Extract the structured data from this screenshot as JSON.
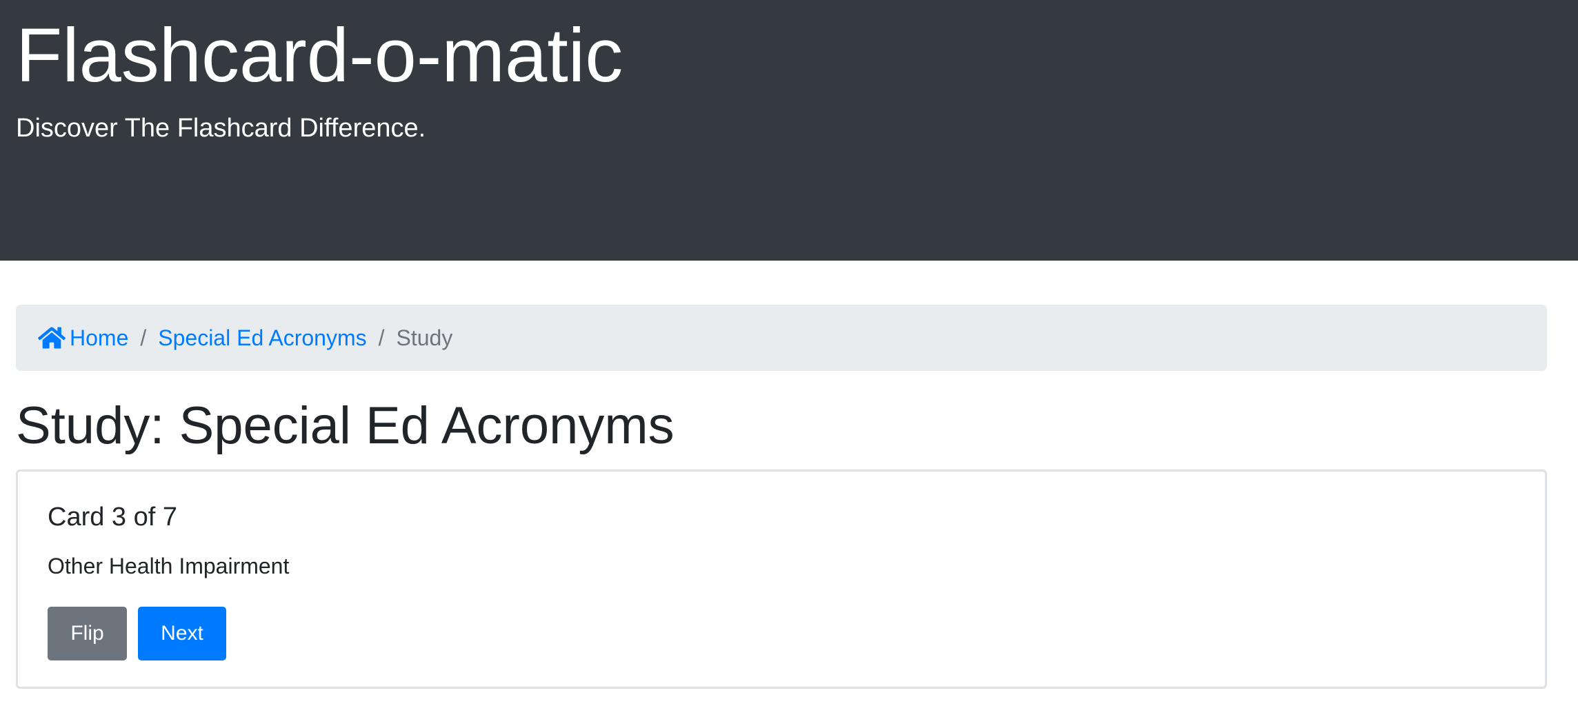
{
  "header": {
    "title": "Flashcard-o-matic",
    "tagline": "Discover The Flashcard Difference."
  },
  "breadcrumb": {
    "home_icon": "home-icon",
    "home_label": "Home",
    "deck_label": "Special Ed Acronyms",
    "current_label": "Study",
    "separator": "/"
  },
  "page": {
    "title": "Study: Special Ed Acronyms"
  },
  "card": {
    "counter": "Card 3 of 7",
    "text": "Other Health Impairment",
    "flip_label": "Flip",
    "next_label": "Next"
  },
  "colors": {
    "header_bg": "#343a40",
    "link": "#007bff",
    "breadcrumb_bg": "#e9ecef",
    "muted": "#6c757d",
    "primary_button": "#007bff",
    "secondary_button": "#6c757d"
  }
}
